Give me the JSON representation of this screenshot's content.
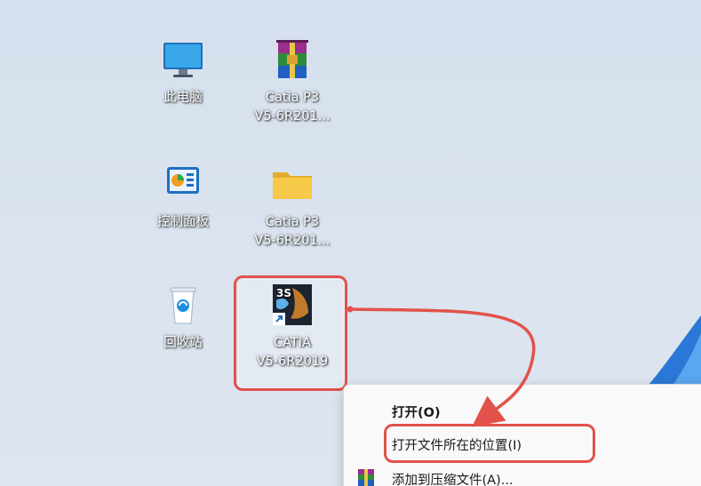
{
  "desktop": {
    "icons": [
      {
        "name": "this-pc",
        "lines": [
          "此电脑"
        ],
        "glyph": "monitor-icon"
      },
      {
        "name": "winrar-archive",
        "lines": [
          "Catia P3",
          "V5-6R201..."
        ],
        "glyph": "winrar-icon"
      },
      {
        "name": "control-panel",
        "lines": [
          "控制面板"
        ],
        "glyph": "control-panel-icon"
      },
      {
        "name": "catia-folder",
        "lines": [
          "Catia P3",
          "V5-6R201..."
        ],
        "glyph": "folder-icon"
      },
      {
        "name": "recycle-bin",
        "lines": [
          "回收站"
        ],
        "glyph": "recycle-bin-icon"
      },
      {
        "name": "catia-shortcut",
        "lines": [
          "CATIA",
          "V5-6R2019"
        ],
        "glyph": "catia-3ds-icon"
      }
    ]
  },
  "context_menu": {
    "items": [
      {
        "label": "打开(O)",
        "bold": true
      },
      {
        "label": "打开文件所在的位置(I)",
        "bold": false
      },
      {
        "label": "添加到压缩文件(A)...",
        "bold": false,
        "icon": "winrar-icon"
      }
    ]
  },
  "colors": {
    "annotation": "#e2524a",
    "folder": "#f7c948",
    "desktop_bg": "#d9e2ef"
  }
}
